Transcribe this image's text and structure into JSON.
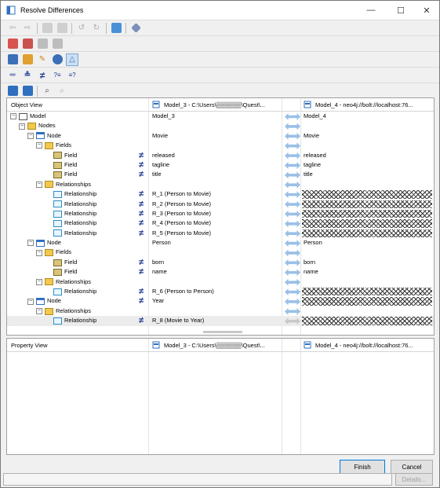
{
  "window": {
    "title": "Resolve Differences",
    "minimize": "—",
    "maximize": "☐",
    "close": "✕"
  },
  "object_view": {
    "header": "Object View",
    "left_model": "Model_3 - C:\\Users\\▒▒▒▒▒▒\\Quest\\...",
    "right_model": "Model_4 - neo4j://bolt://localhost:76...",
    "rows": [
      {
        "indent": 0,
        "exp": "⊟",
        "icon": "model",
        "label": "Model",
        "neq": false,
        "left": "Model_3",
        "right": "Model_4",
        "hatch": false
      },
      {
        "indent": 1,
        "exp": "⊟",
        "icon": "folder",
        "label": "Nodes",
        "neq": false,
        "left": "",
        "right": "",
        "hatch": false
      },
      {
        "indent": 2,
        "exp": "⊟",
        "icon": "node",
        "label": "Node",
        "neq": false,
        "left": "Movie",
        "right": "Movie",
        "hatch": false
      },
      {
        "indent": 3,
        "exp": "⊟",
        "icon": "folder",
        "label": "Fields",
        "neq": false,
        "left": "",
        "right": "",
        "hatch": false
      },
      {
        "indent": 4,
        "exp": "",
        "icon": "field",
        "label": "Field",
        "neq": true,
        "left": "released",
        "right": "released",
        "hatch": false
      },
      {
        "indent": 4,
        "exp": "",
        "icon": "field",
        "label": "Field",
        "neq": true,
        "left": "tagline",
        "right": "tagline",
        "hatch": false
      },
      {
        "indent": 4,
        "exp": "",
        "icon": "field",
        "label": "Field",
        "neq": true,
        "left": "title",
        "right": "title",
        "hatch": false
      },
      {
        "indent": 3,
        "exp": "⊟",
        "icon": "folder",
        "label": "Relationships",
        "neq": false,
        "left": "",
        "right": "",
        "hatch": false
      },
      {
        "indent": 4,
        "exp": "",
        "icon": "rel",
        "label": "Relationship",
        "neq": true,
        "left": "R_1 (Person to Movie)",
        "right": "",
        "hatch": true
      },
      {
        "indent": 4,
        "exp": "",
        "icon": "rel",
        "label": "Relationship",
        "neq": true,
        "left": "R_2 (Person to Movie)",
        "right": "",
        "hatch": true
      },
      {
        "indent": 4,
        "exp": "",
        "icon": "rel",
        "label": "Relationship",
        "neq": true,
        "left": "R_3 (Person to Movie)",
        "right": "",
        "hatch": true
      },
      {
        "indent": 4,
        "exp": "",
        "icon": "rel",
        "label": "Relationship",
        "neq": true,
        "left": "R_4 (Person to Movie)",
        "right": "",
        "hatch": true
      },
      {
        "indent": 4,
        "exp": "",
        "icon": "rel",
        "label": "Relationship",
        "neq": true,
        "left": "R_5 (Person to Movie)",
        "right": "",
        "hatch": true
      },
      {
        "indent": 2,
        "exp": "⊟",
        "icon": "node",
        "label": "Node",
        "neq": false,
        "left": "Person",
        "right": "Person",
        "hatch": false
      },
      {
        "indent": 3,
        "exp": "⊟",
        "icon": "folder",
        "label": "Fields",
        "neq": false,
        "left": "",
        "right": "",
        "hatch": false
      },
      {
        "indent": 4,
        "exp": "",
        "icon": "field",
        "label": "Field",
        "neq": true,
        "left": "born",
        "right": "born",
        "hatch": false
      },
      {
        "indent": 4,
        "exp": "",
        "icon": "field",
        "label": "Field",
        "neq": true,
        "left": "name",
        "right": "name",
        "hatch": false
      },
      {
        "indent": 3,
        "exp": "⊟",
        "icon": "folder",
        "label": "Relationships",
        "neq": false,
        "left": "",
        "right": "",
        "hatch": false
      },
      {
        "indent": 4,
        "exp": "",
        "icon": "rel",
        "label": "Relationship",
        "neq": true,
        "left": "R_6 (Person to Person)",
        "right": "",
        "hatch": true
      },
      {
        "indent": 2,
        "exp": "⊟",
        "icon": "node",
        "label": "Node",
        "neq": true,
        "left": "Year",
        "right": "",
        "hatch": true
      },
      {
        "indent": 3,
        "exp": "⊟",
        "icon": "folder",
        "label": "Relationships",
        "neq": false,
        "left": "",
        "right": "",
        "hatch": false
      },
      {
        "indent": 4,
        "exp": "",
        "icon": "rel",
        "label": "Relationship",
        "neq": true,
        "left": "R_8 (Movie to Year)",
        "right": "",
        "hatch": true,
        "selected": true
      }
    ]
  },
  "property_view": {
    "header": "Property View",
    "left_model": "Model_3 - C:\\Users\\▒▒▒▒▒▒\\Quest\\...",
    "right_model": "Model_4 - neo4j://bolt://localhost:76..."
  },
  "buttons": {
    "finish": "Finish",
    "cancel": "Cancel",
    "details": "Details..."
  },
  "colors": {
    "accent": "#0078d7",
    "neq": "#1f3a93",
    "arrow": "#9ac0e6"
  }
}
